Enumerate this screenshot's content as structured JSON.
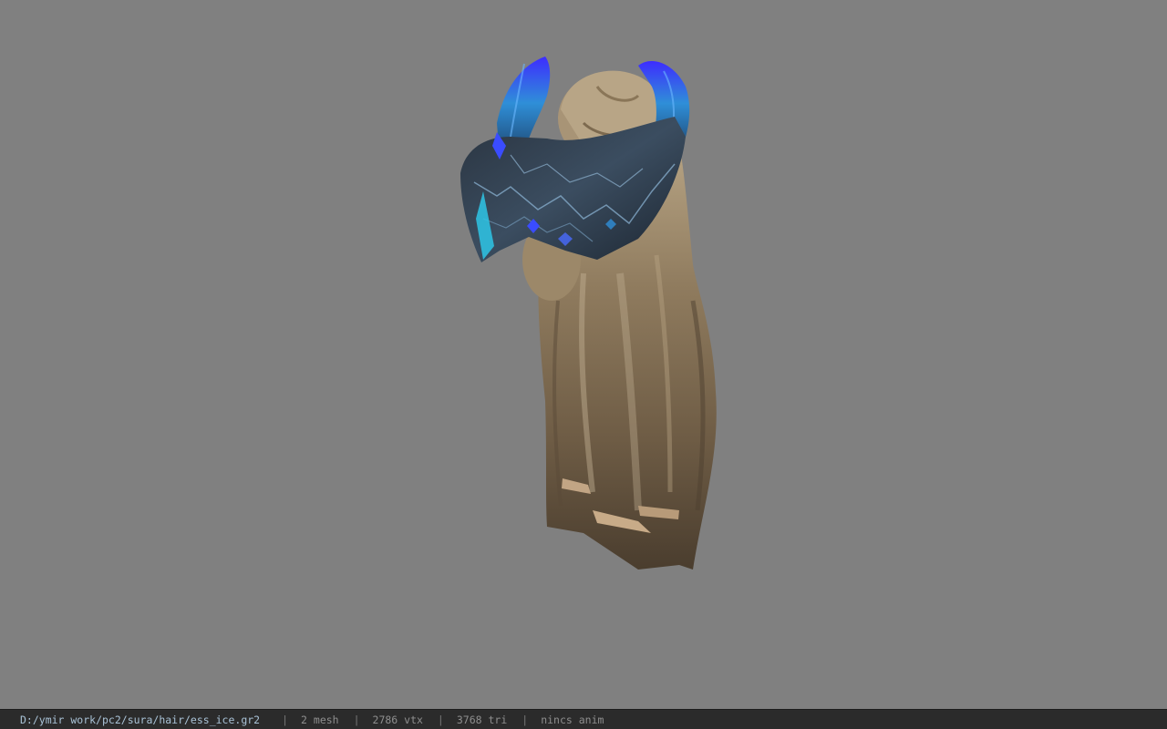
{
  "viewport": {
    "background": "#808080",
    "model_name": "sura hair ess_ice"
  },
  "status": {
    "file_path": "D:/ymir work/pc2/sura/hair/ess_ice.gr2",
    "separator": "|",
    "mesh": "2 mesh",
    "vertices": "2786 vtx",
    "triangles": "3768 tri",
    "anim": "nincs anim"
  },
  "colors": {
    "statusbar_bg": "#2b2b2b",
    "path_text": "#a9c2d6",
    "info_text": "#8e8e8e"
  }
}
